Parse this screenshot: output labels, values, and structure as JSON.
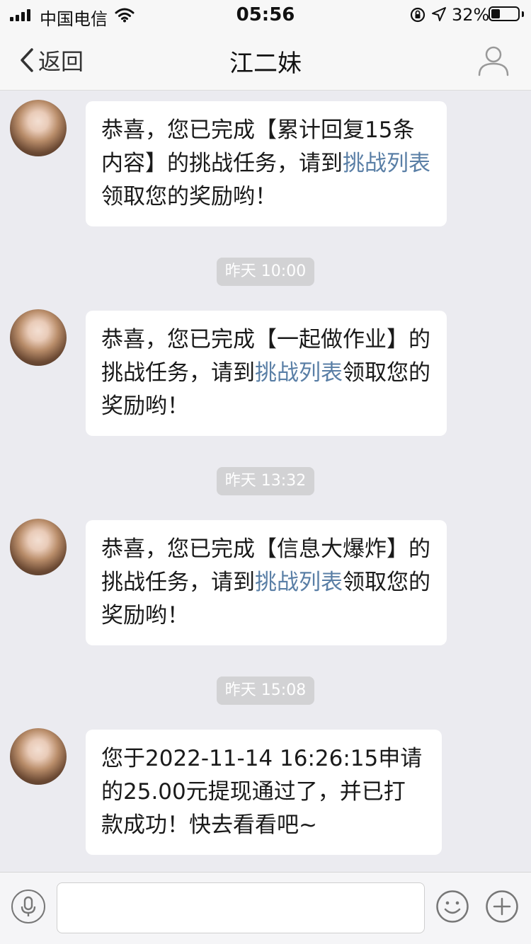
{
  "status_bar": {
    "carrier": "中国电信",
    "time": "05:56",
    "battery_percent": "32%",
    "battery_level": 0.32
  },
  "nav": {
    "back_label": "返回",
    "title": "江二妹"
  },
  "messages": [
    {
      "parts": [
        "恭喜，您已完成【累计回复15条内容】的挑战任务，请到",
        "挑战列表",
        "领取您的奖励哟！"
      ]
    },
    {
      "timestamp": "昨天 10:00"
    },
    {
      "parts": [
        "恭喜，您已完成【一起做作业】的挑战任务，请到",
        "挑战列表",
        "领取您的奖励哟！"
      ]
    },
    {
      "timestamp": "昨天 13:32"
    },
    {
      "parts": [
        "恭喜，您已完成【信息大爆炸】的挑战任务，请到",
        "挑战列表",
        "领取您的奖励哟！"
      ]
    },
    {
      "timestamp": "昨天 15:08"
    },
    {
      "parts": [
        "您于2022-11-14 16:26:15申请的25.00元提现通过了，并已打款成功！快去看看吧~"
      ]
    }
  ],
  "input_bar": {
    "placeholder": ""
  }
}
